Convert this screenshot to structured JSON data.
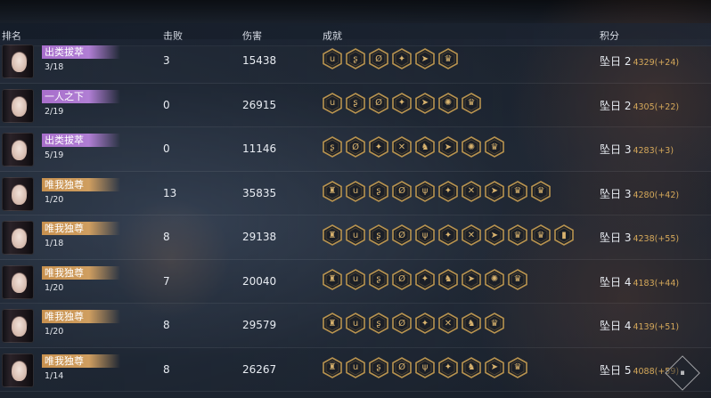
{
  "header": {
    "rank": "排名",
    "kills": "击败",
    "damage": "伤害",
    "achievements": "成就",
    "score": "积分"
  },
  "rows": [
    {
      "title": "出类拔萃",
      "title_color": "purple",
      "progress": "3/18",
      "kills": "3",
      "damage": "15438",
      "achievements": [
        "ս",
        "ʂ",
        "Ø",
        "✦",
        "➤",
        "♛"
      ],
      "rank_label": "坠日 2",
      "score_total": "4329",
      "score_delta": "(+24)"
    },
    {
      "title": "一人之下",
      "title_color": "purple",
      "progress": "2/19",
      "kills": "0",
      "damage": "26915",
      "achievements": [
        "ս",
        "ʂ",
        "Ø",
        "✦",
        "➤",
        "✺",
        "♛"
      ],
      "rank_label": "坠日 2",
      "score_total": "4305",
      "score_delta": "(+22)"
    },
    {
      "title": "出类拔萃",
      "title_color": "purple",
      "progress": "5/19",
      "kills": "0",
      "damage": "11146",
      "achievements": [
        "ʂ",
        "Ø",
        "✦",
        "✕",
        "♞",
        "➤",
        "✺",
        "♛"
      ],
      "rank_label": "坠日 3",
      "score_total": "4283",
      "score_delta": "(+3)"
    },
    {
      "title": "唯我独尊",
      "title_color": "gold",
      "progress": "1/20",
      "kills": "13",
      "damage": "35835",
      "achievements": [
        "♜",
        "ս",
        "ʂ",
        "Ø",
        "ψ",
        "✦",
        "✕",
        "➤",
        "♛",
        "♛"
      ],
      "rank_label": "坠日 3",
      "score_total": "4280",
      "score_delta": "(+42)"
    },
    {
      "title": "唯我独尊",
      "title_color": "gold",
      "progress": "1/18",
      "kills": "8",
      "damage": "29138",
      "achievements": [
        "♜",
        "ս",
        "ʂ",
        "Ø",
        "ψ",
        "✦",
        "✕",
        "➤",
        "♛",
        "♛",
        "▮"
      ],
      "rank_label": "坠日 3",
      "score_total": "4238",
      "score_delta": "(+55)"
    },
    {
      "title": "唯我独尊",
      "title_color": "gold",
      "progress": "1/20",
      "kills": "7",
      "damage": "20040",
      "achievements": [
        "♜",
        "ս",
        "ʂ",
        "Ø",
        "✦",
        "♞",
        "➤",
        "✺",
        "♛"
      ],
      "rank_label": "坠日 4",
      "score_total": "4183",
      "score_delta": "(+44)"
    },
    {
      "title": "唯我独尊",
      "title_color": "gold",
      "progress": "1/20",
      "kills": "8",
      "damage": "29579",
      "achievements": [
        "♜",
        "ս",
        "ʂ",
        "Ø",
        "✦",
        "✕",
        "♞",
        "♛"
      ],
      "rank_label": "坠日 4",
      "score_total": "4139",
      "score_delta": "(+51)"
    },
    {
      "title": "唯我独尊",
      "title_color": "gold",
      "progress": "1/14",
      "kills": "8",
      "damage": "26267",
      "achievements": [
        "♜",
        "ս",
        "ʂ",
        "Ø",
        "ψ",
        "✦",
        "♞",
        "➤",
        "♛"
      ],
      "rank_label": "坠日 5",
      "score_total": "4088",
      "score_delta": "(+59)"
    }
  ],
  "corner_button": {
    "icon": "⏸"
  },
  "colors": {
    "accent_gold": "#d5a85a",
    "badge_purple": "#a86fcb",
    "badge_gold": "#c8914f"
  }
}
